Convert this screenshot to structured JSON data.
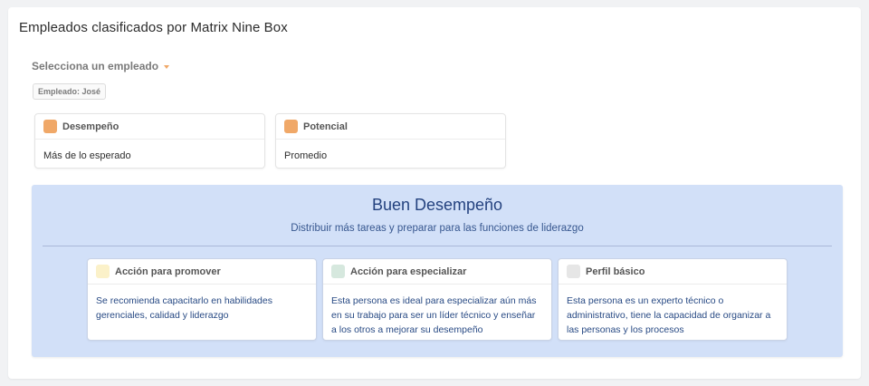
{
  "panel": {
    "title": "Empleados clasificados por Matrix Nine Box"
  },
  "selector": {
    "label": "Selecciona un empleado"
  },
  "tag": {
    "label": "Empleado: José"
  },
  "metrics": [
    {
      "label": "Desempeño",
      "value": "Más de lo esperado",
      "color": "#f0a868"
    },
    {
      "label": "Potencial",
      "value": "Promedio",
      "color": "#f0a868"
    }
  ],
  "result": {
    "title": "Buen Desempeño",
    "subtitle": "Distribuir más tareas y preparar para las funciones de liderazgo",
    "cards": [
      {
        "label": "Acción para promover",
        "text": "Se recomienda capacitarlo en habilidades gerenciales, calidad y liderazgo",
        "color": "#fbf1c9"
      },
      {
        "label": "Acción para especializar",
        "text": "Esta persona es ideal para especializar aún más en su trabajo para ser un líder técnico y enseñar a los otros a mejorar su desempeño",
        "color": "#d6e8de"
      },
      {
        "label": "Perfil básico",
        "text": "Esta persona es un experto técnico o administrativo, tiene la capacidad de organizar a las personas y los procesos",
        "color": "#e6e6e6"
      }
    ]
  }
}
